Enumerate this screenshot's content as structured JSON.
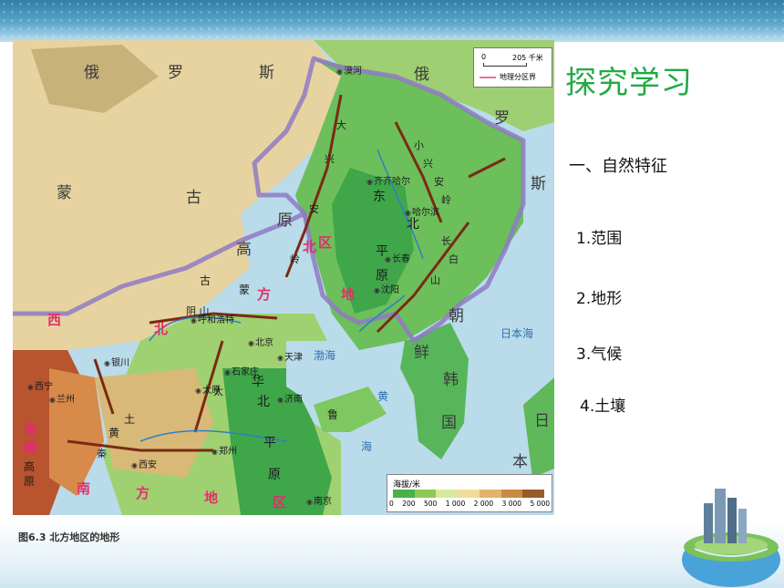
{
  "slide": {
    "title": "探究学习",
    "section_heading": "一、自然特征",
    "outline": [
      "1.范围",
      "2.地形",
      "3.气候",
      "4.土壤"
    ],
    "map_caption": "图6.3  北方地区的地形"
  },
  "map": {
    "scale": {
      "value_label": "205 千米",
      "zero": "0",
      "boundary_legend": "地理分区界"
    },
    "legend": {
      "title": "海拔/米",
      "ticks": [
        "0",
        "200",
        "500",
        "1 000",
        "2 000",
        "3 000",
        "5 000"
      ],
      "colors": [
        "#49b04c",
        "#8ec957",
        "#d7e89a",
        "#f2dc9a",
        "#e4b36a",
        "#c98a44",
        "#9b5a2a"
      ]
    },
    "colors": {
      "boundary": "#8f7ac4",
      "sea": "#b9dbea",
      "mountain_ridge": "#7a2a14",
      "district_label": "#e0306a"
    },
    "labels": {
      "e_russia": "俄",
      "luo": "罗",
      "si": "斯",
      "e2": "俄",
      "luo2": "罗",
      "si2": "斯",
      "meng": "蒙",
      "gu": "古",
      "gao": "高",
      "yuan": "原",
      "meng2": "蒙",
      "gu2": "古",
      "da": "大",
      "xing": "兴",
      "an": "安",
      "ling": "岭",
      "xiao": "小",
      "xing2": "兴",
      "an2": "安",
      "ling2": "岭",
      "dong": "东",
      "bei": "北",
      "ping": "平",
      "yuan2": "原",
      "chang": "长",
      "bai": "白",
      "shan": "山",
      "bei_dist": "北",
      "fang_dist": "方",
      "di_dist": "地",
      "qu_dist": "区",
      "xibei_xi": "西",
      "xibei_bei": "北",
      "nanfang_nan": "南",
      "nanfang_fang": "方",
      "nanfang_di": "地",
      "nanfang_qu": "区",
      "qingzang": "青",
      "zang": "藏",
      "gaoyuan_g": "高",
      "gaoyuan_y": "原",
      "huabei": "华",
      "huabei2": "北",
      "huabei_ping": "平",
      "huabei_yuan": "原",
      "taihang": "太",
      "huangtu_h": "黄",
      "huangtu_t": "土",
      "qinling": "秦",
      "yinshan": "阴 山",
      "shandong": "鲁",
      "chaoxian_c": "朝",
      "chaoxian_x": "鲜",
      "hanguo_h": "韩",
      "hanguo_g": "国",
      "riben_r": "日",
      "riben_b": "本",
      "mohe": "漠河",
      "qiqihaer": "齐齐哈尔",
      "haerbin": "哈尔滨",
      "changchun": "长春",
      "shenyang": "沈阳",
      "huhehaote": "呼和浩特",
      "beijing": "北京",
      "tianjin": "天津",
      "shijiazhuang": "石家庄",
      "taiyuan": "太原",
      "jinan": "济南",
      "zhengzhou": "郑州",
      "xian": "西安",
      "yinchuan": "银川",
      "lanzhou": "兰州",
      "xining": "西宁",
      "nanjing": "南京",
      "bohai": "渤海",
      "huanghai_h": "黄",
      "huanghai_hai": "海",
      "ribenhai": "日本海"
    }
  }
}
